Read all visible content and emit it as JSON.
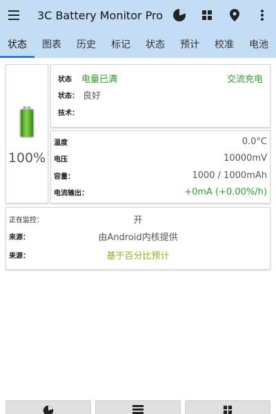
{
  "app": {
    "title": "3C Battery Monitor Pro"
  },
  "appbar_icons": [
    "pie-chart-icon",
    "grid-icon",
    "location-pin-icon",
    "more-vertical-icon"
  ],
  "tabs": [
    {
      "label": "状态",
      "active": true
    },
    {
      "label": "图表"
    },
    {
      "label": "历史"
    },
    {
      "label": "标记"
    },
    {
      "label": "状态"
    },
    {
      "label": "预计"
    },
    {
      "label": "校准"
    },
    {
      "label": "电池"
    }
  ],
  "battery": {
    "percent_text": "100%",
    "level": 1.0
  },
  "status": {
    "row1_label": "状态",
    "row1_value": "电量已满",
    "row1_right": "交流充电",
    "row2_label": "状态：",
    "row2_value": "良好",
    "row3_label": "技术："
  },
  "metrics": {
    "temp_label": "温度",
    "temp_value": "0.0°C",
    "voltage_label": "电压",
    "voltage_value": "10000mV",
    "capacity_label": "容量：",
    "capacity_value": "1000 / 1000mAh",
    "current_label": "电流输出：",
    "current_value": "+0mA (+0.00%/h)"
  },
  "monitor": {
    "monitoring_label": "正在监控：",
    "monitoring_value": "开",
    "source1_label": "来源：",
    "source1_value": "由Android内核提供",
    "source2_label": "来源：",
    "source2_value": "基于百分比预计"
  },
  "bottom_buttons": [
    "pie-chart-icon",
    "list-icon",
    "grid-icon"
  ],
  "colors": {
    "appbar": "#c5dcf5",
    "accent_green": "#2e9b2e",
    "accent_olive": "#9aab20",
    "tab_indicator": "#2a7fd6"
  }
}
